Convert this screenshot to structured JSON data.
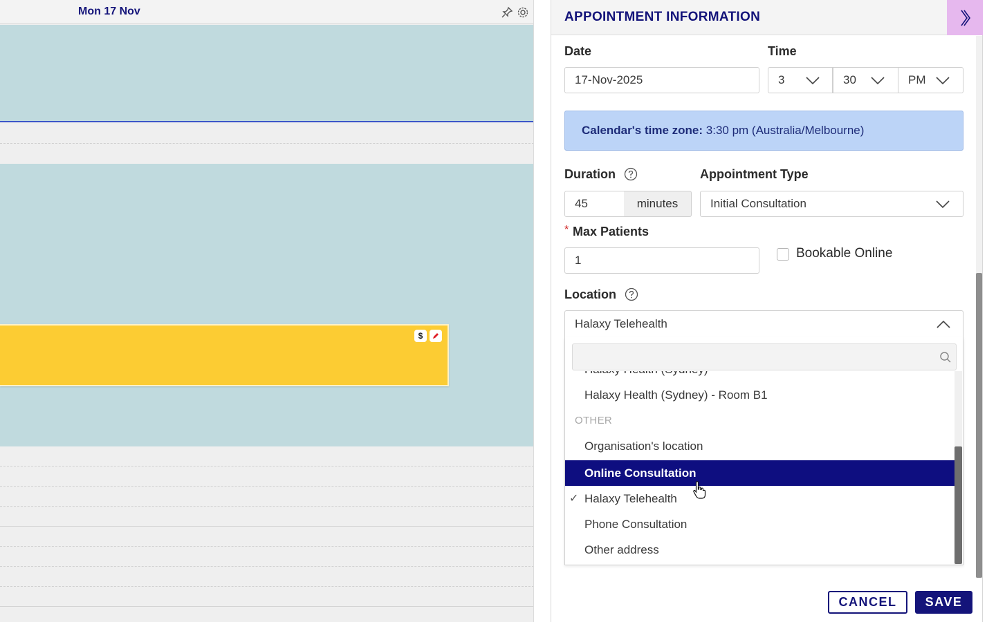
{
  "calendar": {
    "day_header": "Mon 17 Nov",
    "icons": [
      "pin-icon",
      "gear-icon",
      "dollar-icon",
      "pencil-icon"
    ]
  },
  "panel": {
    "title": "APPOINTMENT INFORMATION",
    "collapse_icon": "double-chevron-right-icon",
    "date": {
      "label": "Date",
      "value": "17-Nov-2025"
    },
    "time": {
      "label": "Time",
      "hour": "3",
      "minute": "30",
      "meridiem": "PM"
    },
    "timezone_banner": {
      "prefix": "Calendar's time zone:",
      "value": "3:30 pm (Australia/Melbourne)"
    },
    "duration": {
      "label": "Duration",
      "value": "45",
      "unit": "minutes"
    },
    "appointment_type": {
      "label": "Appointment Type",
      "value": "Initial Consultation"
    },
    "max_patients": {
      "label": "Max Patients",
      "required_mark": "*",
      "value": "1"
    },
    "bookable_online": {
      "label": "Bookable Online",
      "checked": false
    },
    "location": {
      "label": "Location",
      "selected": "Halaxy Telehealth",
      "search_placeholder": "",
      "options": [
        {
          "text": "Halaxy Health (Sydney)",
          "type": "item",
          "clipped": true
        },
        {
          "text": "Halaxy Health (Sydney) - Room B1",
          "type": "item"
        },
        {
          "text": "OTHER",
          "type": "group"
        },
        {
          "text": "Organisation's location",
          "type": "item"
        },
        {
          "text": "Online Consultation",
          "type": "item",
          "highlighted": true
        },
        {
          "text": "Halaxy Telehealth",
          "type": "item",
          "checked": true
        },
        {
          "text": "Phone Consultation",
          "type": "item"
        },
        {
          "text": "Other address",
          "type": "item"
        }
      ]
    },
    "actions": {
      "cancel": "CANCEL",
      "save": "SAVE"
    }
  },
  "colors": {
    "brand_navy": "#14147a",
    "calendar_slot": "#c0dade",
    "appointment": "#fccc33",
    "timezone_banner": "#bcd4f7",
    "collapse_button": "#e6b8ee"
  }
}
